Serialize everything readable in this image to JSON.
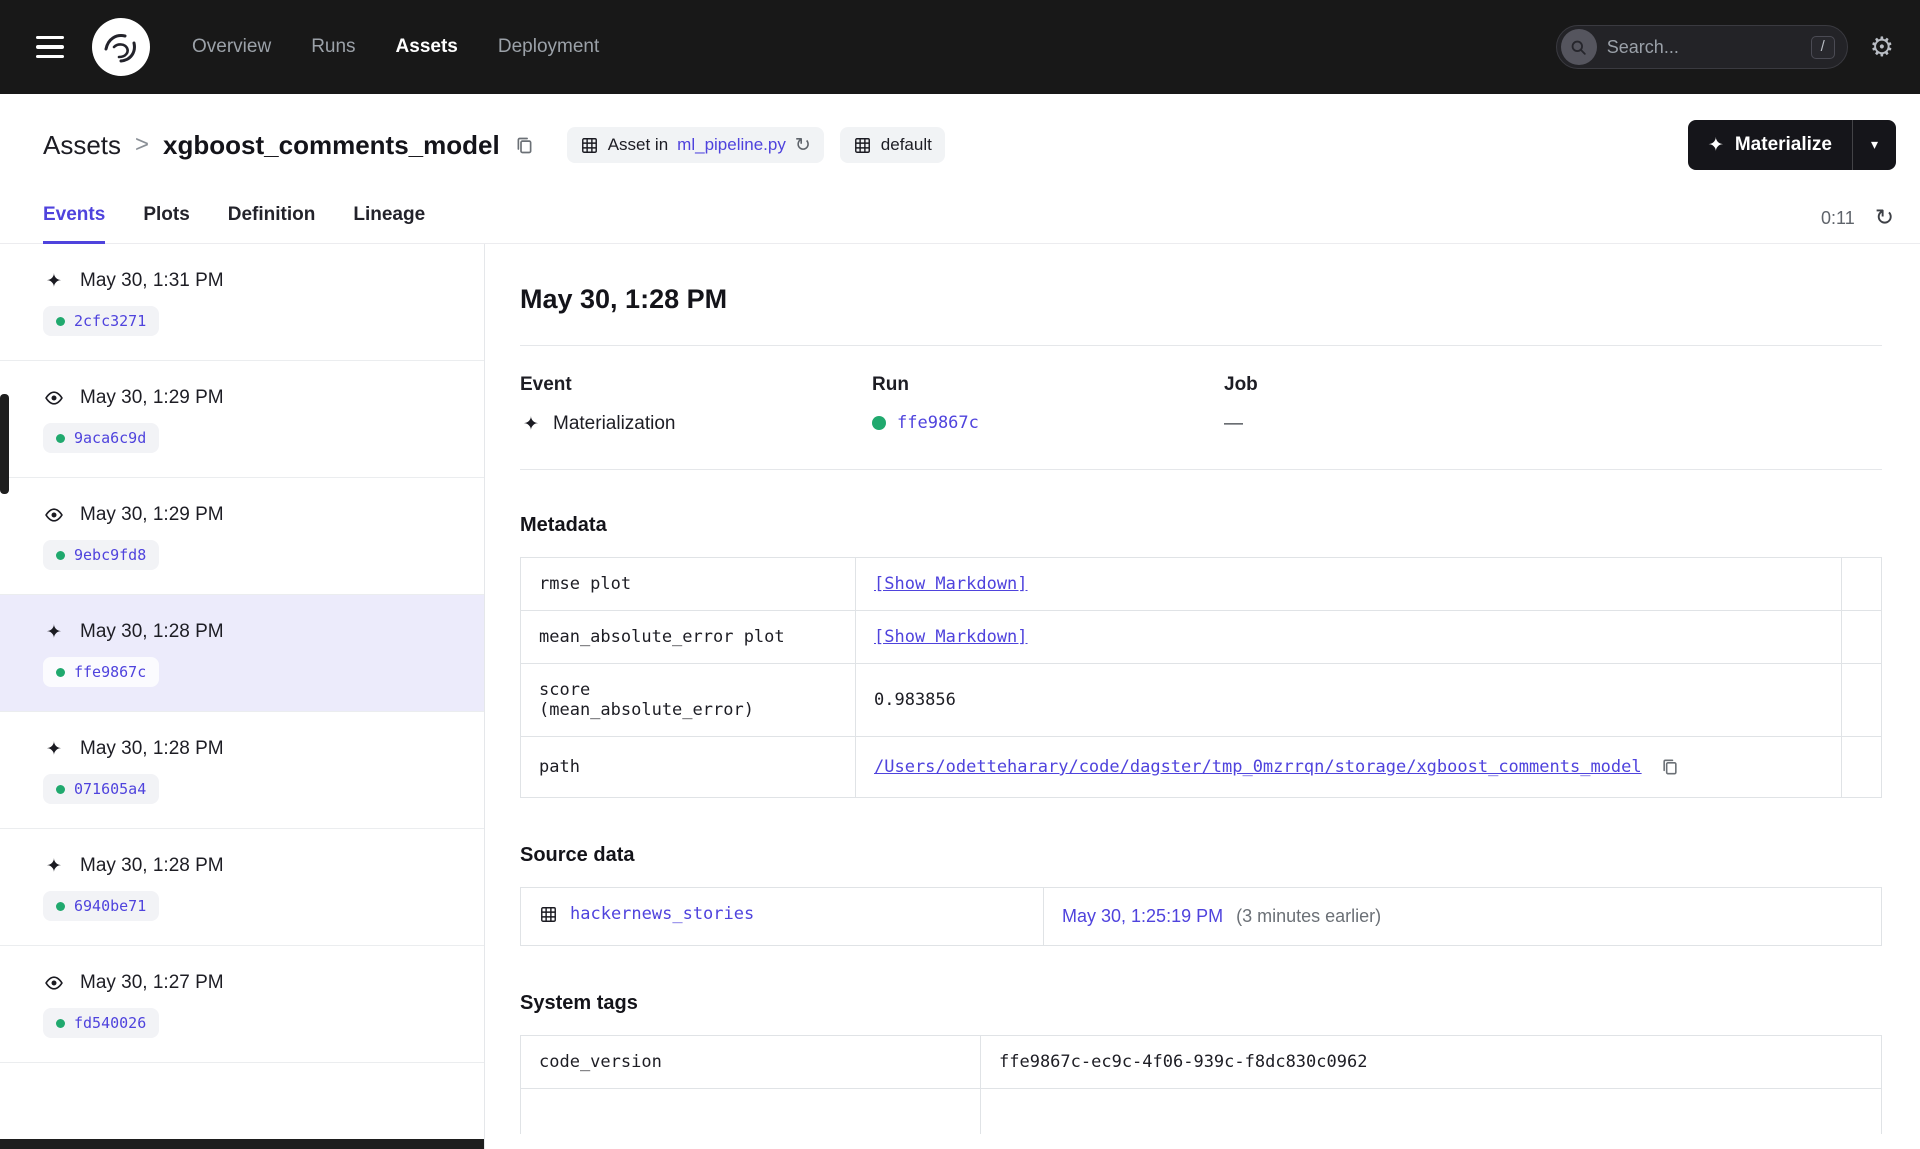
{
  "icons": {
    "materialization_glyph": "✦",
    "refresh_glyph": "↻",
    "gear_glyph": "⚙",
    "caret_glyph": "▾"
  },
  "nav": {
    "items": [
      "Overview",
      "Runs",
      "Assets",
      "Deployment"
    ],
    "active_item": "Assets",
    "search": {
      "placeholder": "Search...",
      "shortcut": "/"
    }
  },
  "header": {
    "breadcrumb": "Assets",
    "separator": ">",
    "title": "xgboost_comments_model",
    "asset_in_label": "Asset in",
    "asset_file": "ml_pipeline.py",
    "group_label": "default",
    "materialize": "Materialize"
  },
  "tabs": {
    "items": [
      "Events",
      "Plots",
      "Definition",
      "Lineage"
    ],
    "active": "Events",
    "timer": "0:11"
  },
  "sidebar": {
    "events": [
      {
        "type": "materialization",
        "time": "May 30, 1:31 PM",
        "run_id": "2cfc3271"
      },
      {
        "type": "observation",
        "time": "May 30, 1:29 PM",
        "run_id": "9aca6c9d"
      },
      {
        "type": "observation",
        "time": "May 30, 1:29 PM",
        "run_id": "9ebc9fd8"
      },
      {
        "type": "materialization",
        "time": "May 30, 1:28 PM",
        "run_id": "ffe9867c",
        "selected": true
      },
      {
        "type": "materialization",
        "time": "May 30, 1:28 PM",
        "run_id": "071605a4"
      },
      {
        "type": "materialization",
        "time": "May 30, 1:28 PM",
        "run_id": "6940be71"
      },
      {
        "type": "observation",
        "time": "May 30, 1:27 PM",
        "run_id": "fd540026"
      }
    ]
  },
  "detail": {
    "heading": "May 30, 1:28 PM",
    "columns": {
      "event_label": "Event",
      "event_value": "Materialization",
      "run_label": "Run",
      "run_value": "ffe9867c",
      "job_label": "Job",
      "job_value": "—"
    },
    "metadata": {
      "title": "Metadata",
      "rows": [
        {
          "key": "rmse plot",
          "value": "[Show Markdown]"
        },
        {
          "key": "mean_absolute_error plot",
          "value": "[Show Markdown]"
        },
        {
          "key": "score\n(mean_absolute_error)",
          "value": "0.983856"
        },
        {
          "key": "path",
          "value": "/Users/odetteharary/code/dagster/tmp_0mzrrqn/storage/xgboost_comments_model"
        }
      ]
    },
    "source": {
      "title": "Source data",
      "asset": "hackernews_stories",
      "timestamp": "May 30, 1:25:19 PM",
      "note": "(3 minutes earlier)"
    },
    "system_tags": {
      "title": "System tags",
      "rows": [
        {
          "key": "code_version",
          "value": "ffe9867c-ec9c-4f06-939c-f8dc830c0962"
        }
      ]
    }
  },
  "colors": {
    "accent": "#4f43dd",
    "success": "#20a96e",
    "nav_bg": "#181818"
  }
}
